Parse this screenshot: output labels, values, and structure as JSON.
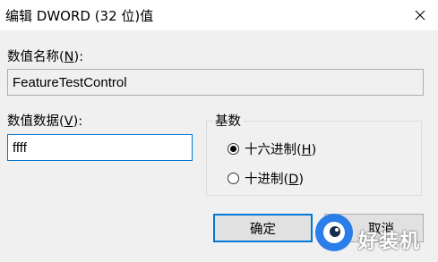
{
  "window": {
    "title": "编辑 DWORD (32 位)值"
  },
  "value_name": {
    "label_prefix": "数值名称(",
    "label_accel": "N",
    "label_suffix": "):",
    "value": "FeatureTestControl"
  },
  "value_data": {
    "label_prefix": "数值数据(",
    "label_accel": "V",
    "label_suffix": "):",
    "value": "ffff"
  },
  "base": {
    "title": "基数",
    "options": [
      {
        "label_prefix": "十六进制(",
        "accel": "H",
        "label_suffix": ")",
        "selected": true
      },
      {
        "label_prefix": "十进制(",
        "accel": "D",
        "label_suffix": ")",
        "selected": false
      }
    ]
  },
  "buttons": {
    "ok": "确定",
    "cancel": "取消"
  },
  "watermark": {
    "text": "好装机"
  },
  "colors": {
    "accent": "#0078d7",
    "watermark_blue": "#2b7de9"
  }
}
